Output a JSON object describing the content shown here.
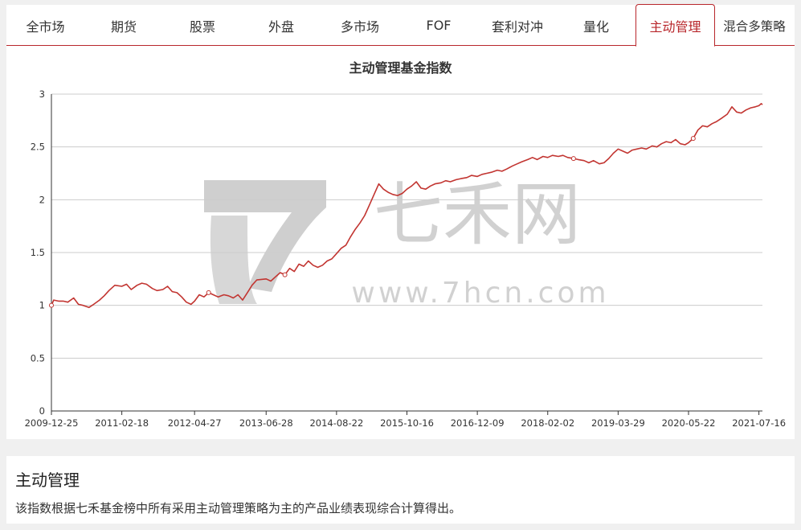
{
  "tabs": [
    {
      "label": "全市场",
      "active": false
    },
    {
      "label": "期货",
      "active": false
    },
    {
      "label": "股票",
      "active": false
    },
    {
      "label": "外盘",
      "active": false
    },
    {
      "label": "多市场",
      "active": false
    },
    {
      "label": "FOF",
      "active": false
    },
    {
      "label": "套利对冲",
      "active": false
    },
    {
      "label": "量化",
      "active": false
    },
    {
      "label": "主动管理",
      "active": true
    },
    {
      "label": "混合多策略",
      "active": false
    }
  ],
  "watermark": {
    "logo_text": "七禾网",
    "url_text": "www.7hcn.com"
  },
  "colors": {
    "accent": "#b8262b",
    "line": "#c23531",
    "grid": "#cccccc"
  },
  "chart_data": {
    "type": "line",
    "title": "主动管理基金指数",
    "xlabel": "",
    "ylabel": "",
    "x_ticks": [
      "2009-12-25",
      "2011-02-18",
      "2012-04-27",
      "2013-06-28",
      "2014-08-22",
      "2015-10-16",
      "2016-12-09",
      "2018-02-02",
      "2019-03-29",
      "2020-05-22",
      "2021-07-16"
    ],
    "y_ticks": [
      "0",
      "0.5",
      "1",
      "1.5",
      "2",
      "2.5",
      "3"
    ],
    "ylim": [
      0,
      3
    ],
    "x_range": [
      "2009-12-25",
      "2021-08-06"
    ],
    "grid": "horizontal",
    "series": [
      {
        "values": [
          [
            "2009-12-25",
            1.0
          ],
          [
            "2010-01-08",
            1.05
          ],
          [
            "2010-02-05",
            1.04
          ],
          [
            "2010-03-05",
            1.04
          ],
          [
            "2010-04-02",
            1.03
          ],
          [
            "2010-05-07",
            1.07
          ],
          [
            "2010-06-04",
            1.01
          ],
          [
            "2010-07-02",
            1.0
          ],
          [
            "2010-08-06",
            0.98
          ],
          [
            "2010-09-03",
            1.01
          ],
          [
            "2010-10-08",
            1.05
          ],
          [
            "2010-11-05",
            1.09
          ],
          [
            "2010-12-03",
            1.14
          ],
          [
            "2011-01-07",
            1.19
          ],
          [
            "2011-02-18",
            1.18
          ],
          [
            "2011-03-18",
            1.2
          ],
          [
            "2011-04-15",
            1.15
          ],
          [
            "2011-05-20",
            1.19
          ],
          [
            "2011-06-17",
            1.21
          ],
          [
            "2011-07-15",
            1.2
          ],
          [
            "2011-08-19",
            1.16
          ],
          [
            "2011-09-16",
            1.14
          ],
          [
            "2011-10-21",
            1.15
          ],
          [
            "2011-11-18",
            1.18
          ],
          [
            "2011-12-16",
            1.13
          ],
          [
            "2012-01-13",
            1.12
          ],
          [
            "2012-02-10",
            1.08
          ],
          [
            "2012-03-09",
            1.03
          ],
          [
            "2012-04-06",
            1.01
          ],
          [
            "2012-04-27",
            1.04
          ],
          [
            "2012-05-25",
            1.1
          ],
          [
            "2012-06-22",
            1.08
          ],
          [
            "2012-07-20",
            1.12
          ],
          [
            "2012-08-17",
            1.1
          ],
          [
            "2012-09-14",
            1.08
          ],
          [
            "2012-10-19",
            1.1
          ],
          [
            "2012-11-16",
            1.09
          ],
          [
            "2012-12-14",
            1.07
          ],
          [
            "2013-01-11",
            1.1
          ],
          [
            "2013-02-08",
            1.05
          ],
          [
            "2013-03-08",
            1.12
          ],
          [
            "2013-04-05",
            1.19
          ],
          [
            "2013-05-03",
            1.24
          ],
          [
            "2013-06-28",
            1.25
          ],
          [
            "2013-07-26",
            1.23
          ],
          [
            "2013-08-23",
            1.27
          ],
          [
            "2013-09-20",
            1.31
          ],
          [
            "2013-10-18",
            1.29
          ],
          [
            "2013-11-15",
            1.35
          ],
          [
            "2013-12-13",
            1.32
          ],
          [
            "2014-01-10",
            1.39
          ],
          [
            "2014-02-07",
            1.37
          ],
          [
            "2014-03-07",
            1.42
          ],
          [
            "2014-04-04",
            1.38
          ],
          [
            "2014-05-02",
            1.36
          ],
          [
            "2014-05-30",
            1.38
          ],
          [
            "2014-06-27",
            1.42
          ],
          [
            "2014-07-25",
            1.44
          ],
          [
            "2014-08-22",
            1.49
          ],
          [
            "2014-09-19",
            1.54
          ],
          [
            "2014-10-17",
            1.57
          ],
          [
            "2014-11-14",
            1.65
          ],
          [
            "2014-12-12",
            1.72
          ],
          [
            "2015-01-09",
            1.78
          ],
          [
            "2015-02-06",
            1.85
          ],
          [
            "2015-03-06",
            1.95
          ],
          [
            "2015-04-03",
            2.05
          ],
          [
            "2015-05-01",
            2.15
          ],
          [
            "2015-05-29",
            2.1
          ],
          [
            "2015-06-26",
            2.07
          ],
          [
            "2015-07-24",
            2.05
          ],
          [
            "2015-08-21",
            2.04
          ],
          [
            "2015-09-18",
            2.06
          ],
          [
            "2015-10-16",
            2.1
          ],
          [
            "2015-11-13",
            2.13
          ],
          [
            "2015-12-11",
            2.17
          ],
          [
            "2016-01-08",
            2.11
          ],
          [
            "2016-02-05",
            2.1
          ],
          [
            "2016-03-04",
            2.13
          ],
          [
            "2016-04-01",
            2.15
          ],
          [
            "2016-05-06",
            2.16
          ],
          [
            "2016-06-03",
            2.18
          ],
          [
            "2016-07-01",
            2.17
          ],
          [
            "2016-08-05",
            2.19
          ],
          [
            "2016-09-02",
            2.2
          ],
          [
            "2016-10-07",
            2.21
          ],
          [
            "2016-11-04",
            2.23
          ],
          [
            "2016-12-09",
            2.22
          ],
          [
            "2017-01-06",
            2.24
          ],
          [
            "2017-02-03",
            2.25
          ],
          [
            "2017-03-03",
            2.26
          ],
          [
            "2017-04-07",
            2.28
          ],
          [
            "2017-05-05",
            2.27
          ],
          [
            "2017-06-02",
            2.29
          ],
          [
            "2017-07-07",
            2.32
          ],
          [
            "2017-08-04",
            2.34
          ],
          [
            "2017-09-01",
            2.36
          ],
          [
            "2017-10-06",
            2.38
          ],
          [
            "2017-11-03",
            2.4
          ],
          [
            "2017-12-01",
            2.38
          ],
          [
            "2018-01-05",
            2.41
          ],
          [
            "2018-02-02",
            2.4
          ],
          [
            "2018-03-02",
            2.42
          ],
          [
            "2018-04-06",
            2.41
          ],
          [
            "2018-05-04",
            2.42
          ],
          [
            "2018-06-01",
            2.4
          ],
          [
            "2018-07-06",
            2.39
          ],
          [
            "2018-08-03",
            2.38
          ],
          [
            "2018-09-07",
            2.37
          ],
          [
            "2018-10-05",
            2.35
          ],
          [
            "2018-11-02",
            2.37
          ],
          [
            "2018-12-07",
            2.34
          ],
          [
            "2019-01-04",
            2.35
          ],
          [
            "2019-02-01",
            2.39
          ],
          [
            "2019-03-01",
            2.44
          ],
          [
            "2019-03-29",
            2.48
          ],
          [
            "2019-04-26",
            2.46
          ],
          [
            "2019-05-24",
            2.44
          ],
          [
            "2019-06-21",
            2.47
          ],
          [
            "2019-07-19",
            2.48
          ],
          [
            "2019-08-16",
            2.49
          ],
          [
            "2019-09-13",
            2.48
          ],
          [
            "2019-10-18",
            2.51
          ],
          [
            "2019-11-15",
            2.5
          ],
          [
            "2019-12-13",
            2.53
          ],
          [
            "2020-01-10",
            2.55
          ],
          [
            "2020-02-07",
            2.54
          ],
          [
            "2020-03-06",
            2.57
          ],
          [
            "2020-04-03",
            2.53
          ],
          [
            "2020-05-01",
            2.52
          ],
          [
            "2020-05-22",
            2.54
          ],
          [
            "2020-06-19",
            2.58
          ],
          [
            "2020-07-17",
            2.66
          ],
          [
            "2020-08-14",
            2.7
          ],
          [
            "2020-09-11",
            2.69
          ],
          [
            "2020-10-09",
            2.72
          ],
          [
            "2020-11-06",
            2.74
          ],
          [
            "2020-12-04",
            2.77
          ],
          [
            "2021-01-08",
            2.81
          ],
          [
            "2021-02-05",
            2.88
          ],
          [
            "2021-03-05",
            2.83
          ],
          [
            "2021-04-02",
            2.82
          ],
          [
            "2021-04-30",
            2.85
          ],
          [
            "2021-05-28",
            2.87
          ],
          [
            "2021-06-25",
            2.88
          ],
          [
            "2021-07-16",
            2.89
          ],
          [
            "2021-07-30",
            2.91
          ],
          [
            "2021-08-06",
            2.9
          ]
        ]
      }
    ]
  },
  "info": {
    "title": "主动管理",
    "description": "该指数根据七禾基金榜中所有采用主动管理策略为主的产品业绩表现综合计算得出。"
  }
}
